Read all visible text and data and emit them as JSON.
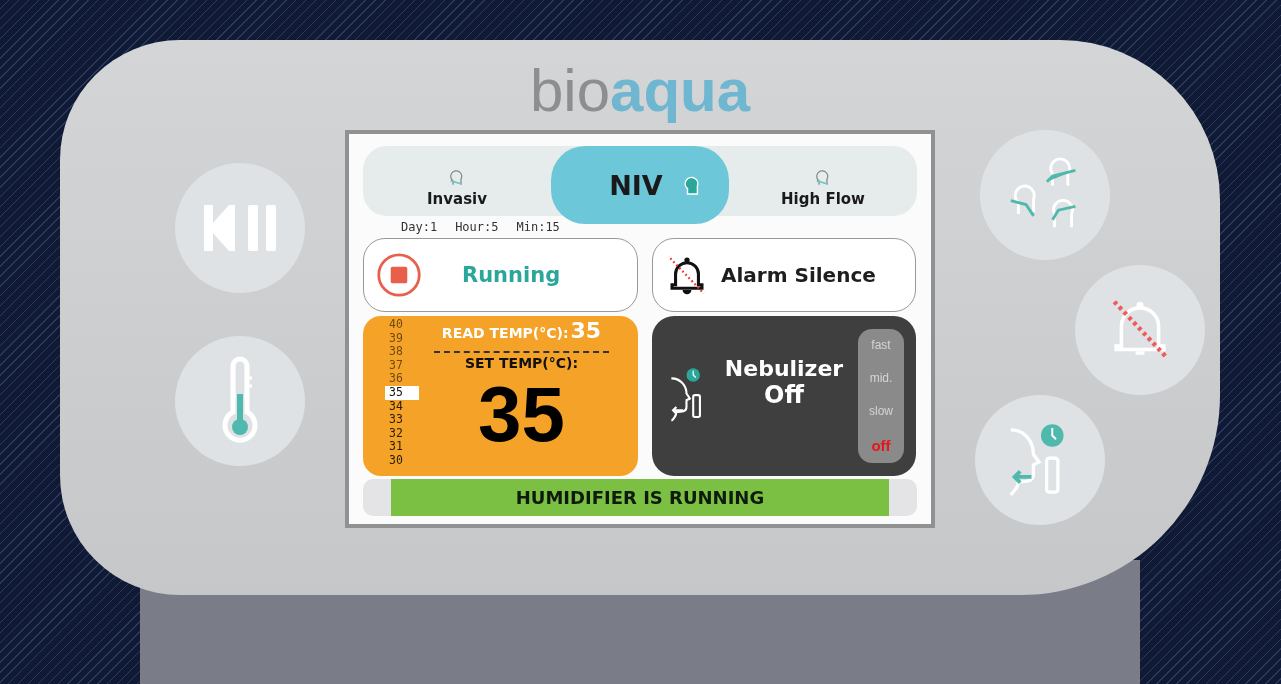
{
  "logo": {
    "plain": "bio",
    "accent": "aqua"
  },
  "modes": [
    {
      "label": "Invasiv",
      "selected": false
    },
    {
      "label": "NIV",
      "selected": true
    },
    {
      "label": "High Flow",
      "selected": false
    }
  ],
  "timer": [
    "Day:1",
    "Hour:5",
    "Min:15"
  ],
  "run_button": {
    "label": "Running"
  },
  "alarm_button": {
    "label": "Alarm Silence"
  },
  "temperature": {
    "read_label": "READ TEMP(°C):",
    "read_value": "35",
    "set_label": "SET TEMP(°C):",
    "set_value": "35",
    "scale": [
      {
        "value": "40",
        "selected": false
      },
      {
        "value": "39",
        "selected": false
      },
      {
        "value": "38",
        "selected": false
      },
      {
        "value": "37",
        "selected": false
      },
      {
        "value": "36",
        "selected": false
      },
      {
        "value": "35",
        "selected": true
      },
      {
        "value": "34",
        "selected": false
      },
      {
        "value": "33",
        "selected": false
      },
      {
        "value": "32",
        "selected": false
      },
      {
        "value": "31",
        "selected": false
      },
      {
        "value": "30",
        "selected": false
      }
    ]
  },
  "nebulizer": {
    "title": "Nebulizer",
    "state": "Off",
    "speeds": [
      {
        "label": "fast",
        "selected": false
      },
      {
        "label": "mid.",
        "selected": false
      },
      {
        "label": "slow",
        "selected": false
      },
      {
        "label": "off",
        "selected": true
      }
    ]
  },
  "status_bar": {
    "text": "HUMIDIFIER IS RUNNING"
  }
}
